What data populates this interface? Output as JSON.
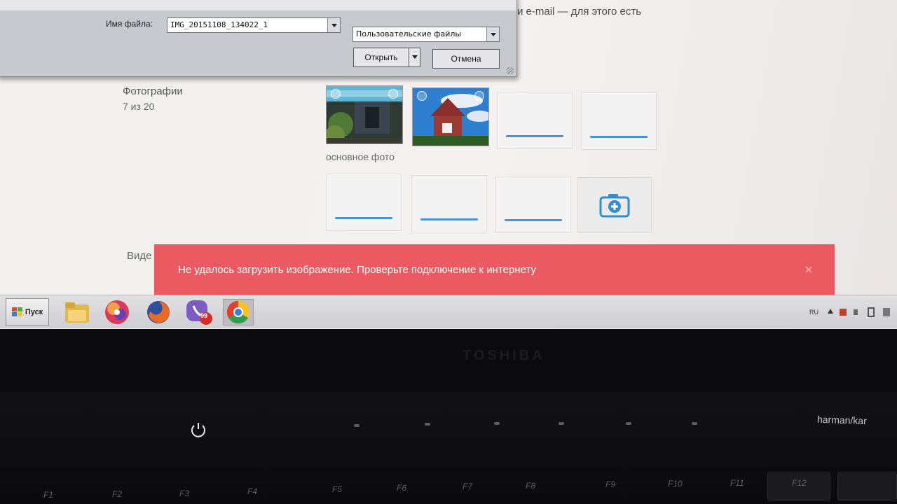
{
  "page": {
    "top_text": "и e-mail — для этого есть"
  },
  "file_dialog": {
    "filename_label": "Имя файла:",
    "filename_value": "IMG_20151108_134022_1",
    "filetype_value": "Пользовательские файлы",
    "open_label": "Открыть",
    "cancel_label": "Отмена"
  },
  "photos": {
    "title": "Фотографии",
    "count": "7 из 20",
    "main_photo_label": "основное фото"
  },
  "video": {
    "label": "Виде"
  },
  "error": {
    "message": "Не удалось загрузить изображение. Проверьте подключение к интернету",
    "close_icon": "close-icon"
  },
  "taskbar": {
    "start_label": "Пуск",
    "badge_count": "99",
    "tray_lang": "RU",
    "apps": [
      "file-manager-icon",
      "app-ball-icon",
      "firefox-icon",
      "viber-icon",
      "chrome-icon"
    ]
  },
  "laptop": {
    "brand": "TOSHIBA",
    "speaker_brand": "harman/kar",
    "fkeys": [
      "F1",
      "F2",
      "F3",
      "F4",
      "F5",
      "F6",
      "F7",
      "F8",
      "F9",
      "F10",
      "F11",
      "F12"
    ]
  },
  "colors": {
    "error_bg": "#ea5a60",
    "accent_blue": "#4b93d6"
  }
}
